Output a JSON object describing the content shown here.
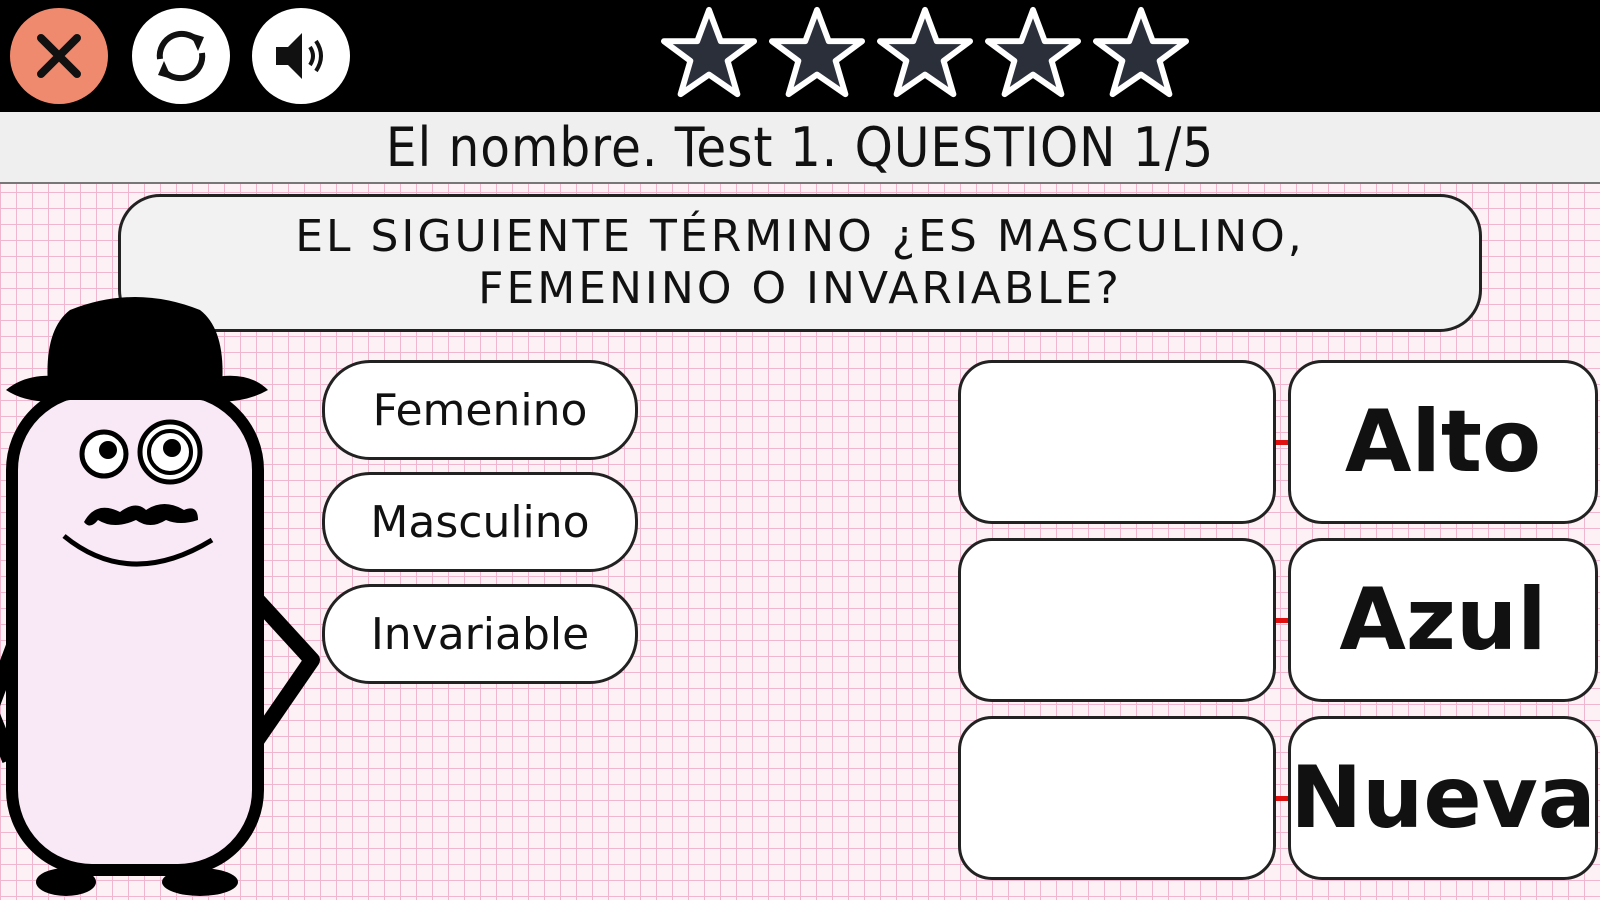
{
  "toolbar": {
    "close_icon": "close-icon",
    "reload_icon": "reload-icon",
    "sound_icon": "speaker-icon",
    "colors": {
      "close_bg": "#f08a6e",
      "bar_bg": "#000000"
    }
  },
  "stars": {
    "total": 5,
    "earned": 0,
    "icon": "star-icon"
  },
  "title": "El nombre. Test 1. QUESTION 1/5",
  "question": "EL SIGUIENTE TÉRMINO ¿ES MASCULINO, FEMENINO O INVARIABLE?",
  "options": [
    {
      "label": "Femenino"
    },
    {
      "label": "Masculino"
    },
    {
      "label": "Invariable"
    }
  ],
  "pairs": [
    {
      "answer": "",
      "word": "Alto"
    },
    {
      "answer": "",
      "word": "Azul"
    },
    {
      "answer": "",
      "word": "Nueva"
    }
  ],
  "mascot": {
    "icon": "mascot-icon"
  }
}
